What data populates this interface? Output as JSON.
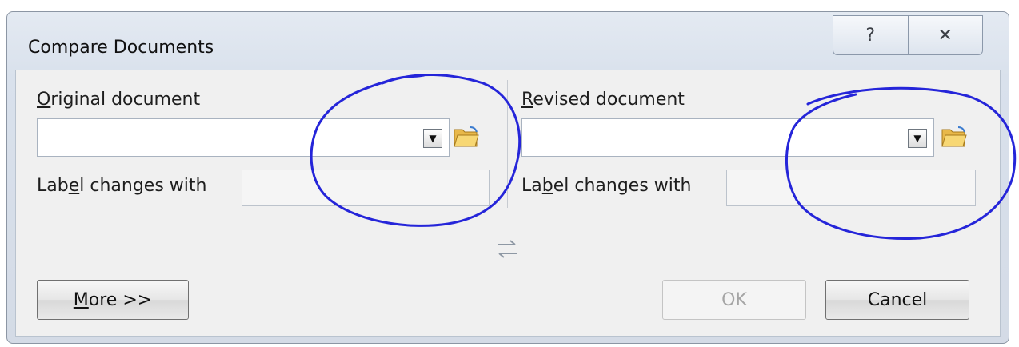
{
  "dialog": {
    "title": "Compare Documents",
    "help_glyph": "?",
    "close_glyph": "✕"
  },
  "original": {
    "label_mnemonic": "O",
    "label_rest": "riginal document",
    "value": "",
    "label_changes_pre": "Lab",
    "label_changes_mnemonic": "e",
    "label_changes_post": "l changes with",
    "label_changes_value": ""
  },
  "revised": {
    "label_mnemonic": "R",
    "label_rest": "evised document",
    "value": "",
    "label_changes_pre": "La",
    "label_changes_mnemonic": "b",
    "label_changes_post": "el changes with",
    "label_changes_value": ""
  },
  "buttons": {
    "more_mnemonic": "M",
    "more_rest": "ore >>",
    "ok": "OK",
    "cancel": "Cancel"
  },
  "icons": {
    "dropdown": "dropdown-arrow-icon",
    "browse": "open-folder-icon",
    "swap": "swap-documents-icon"
  },
  "colors": {
    "annotation": "#2525d9"
  }
}
